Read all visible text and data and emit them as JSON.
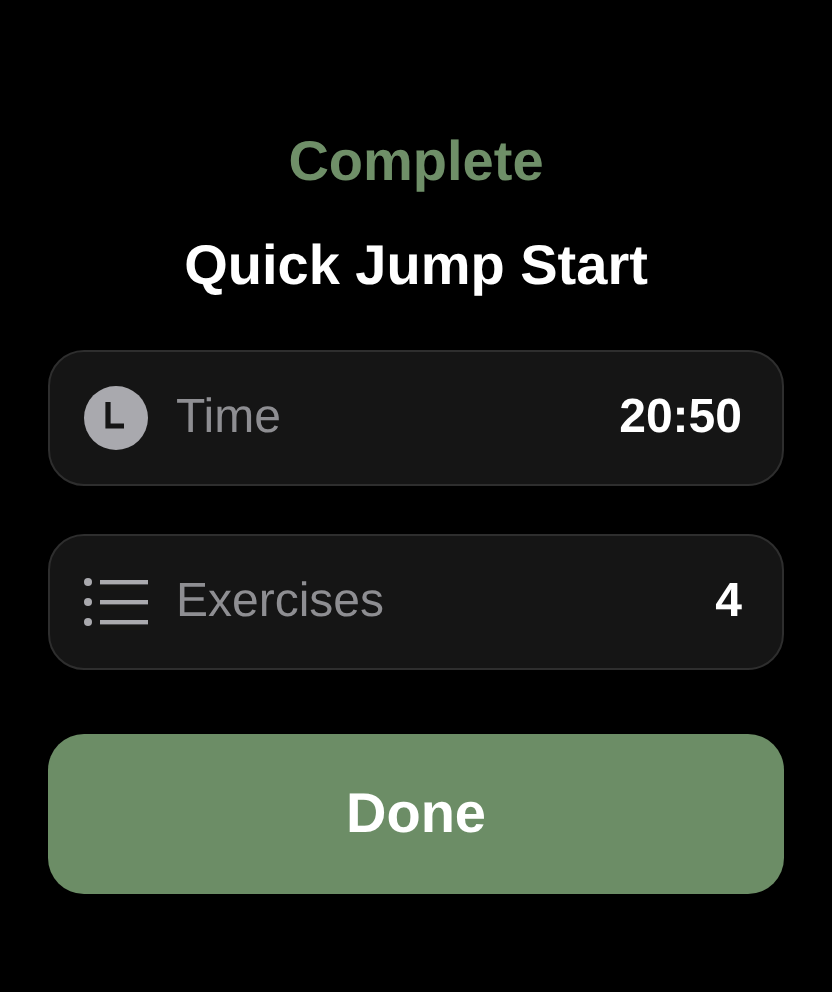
{
  "status": "Complete",
  "title": "Quick Jump Start",
  "stats": [
    {
      "kind": "clock",
      "label": "Time",
      "value": "20:50"
    },
    {
      "kind": "list",
      "label": "Exercises",
      "value": "4"
    }
  ],
  "button": "Done"
}
